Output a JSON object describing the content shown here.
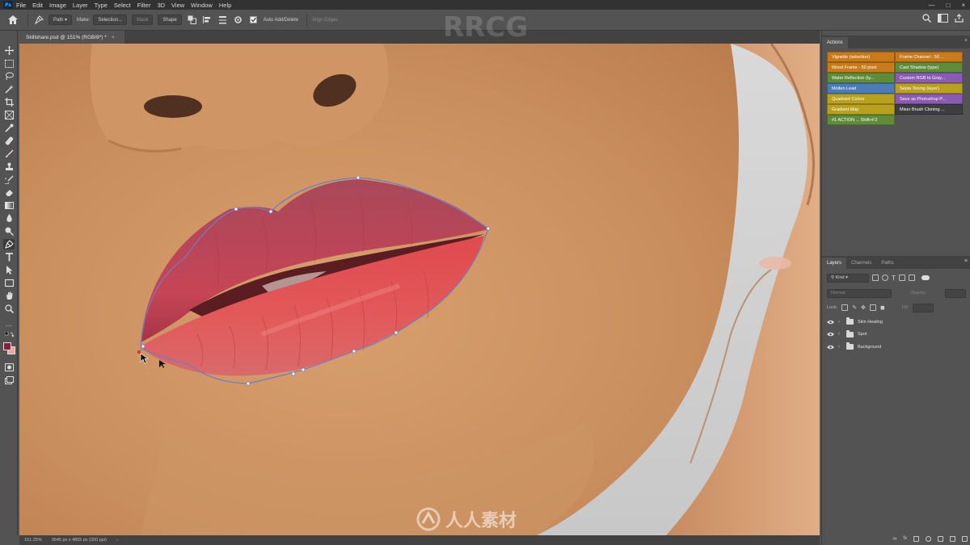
{
  "menubar": {
    "app_icon": "Ps",
    "items": [
      "File",
      "Edit",
      "Image",
      "Layer",
      "Type",
      "Select",
      "Filter",
      "3D",
      "View",
      "Window",
      "Help"
    ],
    "window_controls": [
      "minimize-icon",
      "maximize-icon",
      "close-icon"
    ]
  },
  "options": {
    "tool_icon": "pen-tool-icon",
    "mode_value": "Path",
    "make_label": "Make:",
    "selection_btn": "Selection...",
    "mask_btn": "Mask",
    "shape_btn": "Shape",
    "auto_label": "Auto Add/Delete",
    "align_edges": "Align Edges"
  },
  "document": {
    "tab_title": "Skillshare.psd @ 151% (RGB/8*) *",
    "close_icon": "close-icon"
  },
  "status": {
    "zoom": "151.25%",
    "doc_size": "3645 px x 4855 px (300 ppi)"
  },
  "actions_panel": {
    "tab": "Actions",
    "close": "×",
    "actions": [
      {
        "label": "Vignette (selection)",
        "color": "#c97a1a"
      },
      {
        "label": "Frame Channel - 50 ...",
        "color": "#c97a1a"
      },
      {
        "label": "Wood Frame - 50 pixel",
        "color": "#c97a1a"
      },
      {
        "label": "Cast Shadow (type)",
        "color": "#5f8c3b"
      },
      {
        "label": "Water Reflection (ty...",
        "color": "#5f8c3b"
      },
      {
        "label": "Custom RGB to Gray...",
        "color": "#8a5ab4"
      },
      {
        "label": "Molten Lead",
        "color": "#4a7db8"
      },
      {
        "label": "Sepia Toning (layer)",
        "color": "#b8a11e"
      },
      {
        "label": "Quadrant Colors",
        "color": "#b8a11e"
      },
      {
        "label": "Save as Photoshop P...",
        "color": "#8a5ab4"
      },
      {
        "label": "Gradient Map",
        "color": "#b8a11e"
      },
      {
        "label": "Mixer Brush Cloning ...",
        "color": "#3e3e3e"
      },
      {
        "label": "#1 ACTION ...  Shift+F2",
        "color": "#5f8c3b"
      }
    ]
  },
  "layers_panel": {
    "tabs": [
      "Layers",
      "Channels",
      "Paths"
    ],
    "kind_filter": "Kind",
    "blend_mode": "Normal",
    "opacity_label": "Opacity:",
    "lock_label": "Lock:",
    "fill_label": "Fill:",
    "layers": [
      {
        "name": "Skin Healing",
        "visible": true
      },
      {
        "name": "Spot",
        "visible": true
      },
      {
        "name": "Background",
        "visible": true
      }
    ]
  },
  "watermarks": {
    "top": "RRCG",
    "side": "RRCG",
    "bottom": "人人素材"
  }
}
